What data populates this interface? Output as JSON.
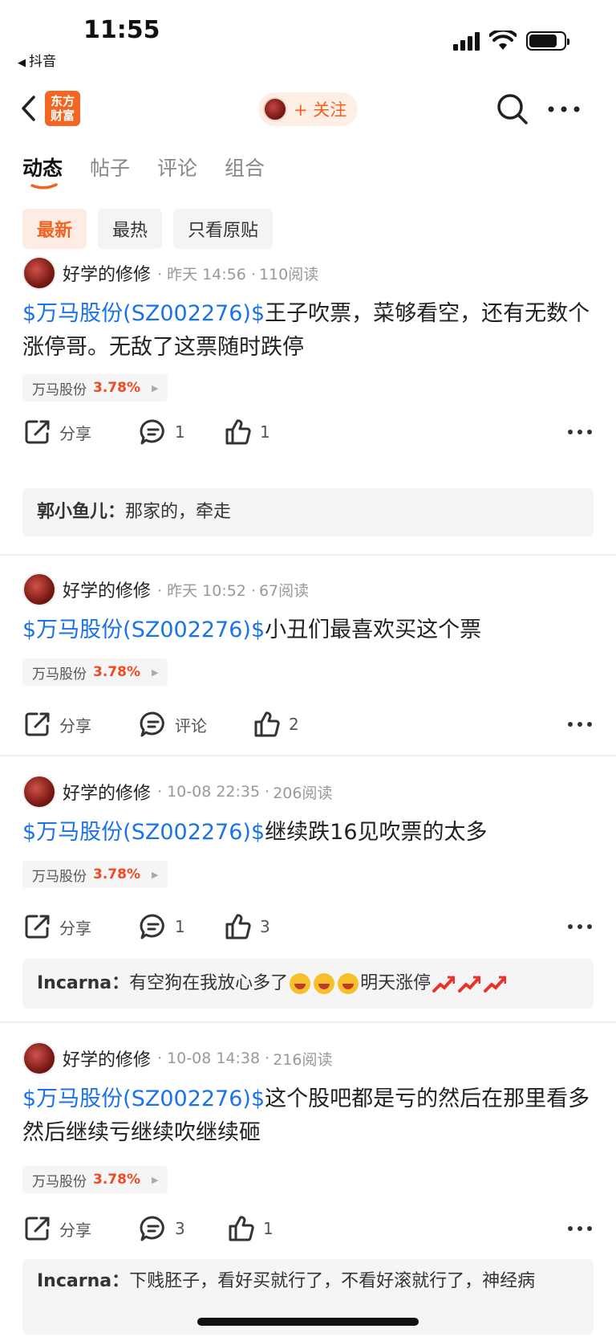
{
  "status_bar": {
    "time": "11:55",
    "back_app": "抖音"
  },
  "nav": {
    "logo_text": "东方财富",
    "follow_label": "+ 关注"
  },
  "tabs": [
    {
      "label": "动态",
      "active": true
    },
    {
      "label": "帖子",
      "active": false
    },
    {
      "label": "评论",
      "active": false
    },
    {
      "label": "组合",
      "active": false
    }
  ],
  "filters": [
    {
      "label": "最新",
      "active": true
    },
    {
      "label": "最热",
      "active": false
    },
    {
      "label": "只看原贴",
      "active": false
    }
  ],
  "colors": {
    "brand": "#f2611f",
    "link": "#1a73e8",
    "up": "#f04a23"
  },
  "posts": [
    {
      "author": "好学的修修",
      "time": "· 昨天 14:56 ·",
      "reads": "110阅读",
      "tag": "$万马股份(SZ002276)$",
      "text": "王子吹票，菜够看空，还有无数个涨停哥。无敌了这票随时跌停",
      "stock_name": "万马股份",
      "stock_pct": "3.78%",
      "share": "分享",
      "comments": "1",
      "likes": "1",
      "reply": {
        "who": "郭小鱼儿：",
        "text": "那家的，牵走"
      }
    },
    {
      "author": "好学的修修",
      "time": "· 昨天 10:52 ·",
      "reads": "67阅读",
      "tag": "$万马股份(SZ002276)$",
      "text": "小丑们最喜欢买这个票",
      "stock_name": "万马股份",
      "stock_pct": "3.78%",
      "share": "分享",
      "comments": "评论",
      "likes": "2"
    },
    {
      "author": "好学的修修",
      "time": "· 10-08 22:35 ·",
      "reads": "206阅读",
      "tag": "$万马股份(SZ002276)$",
      "text": "继续跌16见吹票的太多",
      "stock_name": "万马股份",
      "stock_pct": "3.78%",
      "share": "分享",
      "comments": "1",
      "likes": "3",
      "reply": {
        "who": "Incarna：",
        "text": "有空狗在我放心多了",
        "text2": "明天涨停"
      }
    },
    {
      "author": "好学的修修",
      "time": "· 10-08 14:38 ·",
      "reads": "216阅读",
      "tag": "$万马股份(SZ002276)$",
      "text": "这个股吧都是亏的然后在那里看多然后继续亏继续吹继续砸",
      "stock_name": "万马股份",
      "stock_pct": "3.78%",
      "share": "分享",
      "comments": "3",
      "likes": "1",
      "reply": {
        "who": "Incarna：",
        "text": "下贱胚子，看好买就行了，不看好滚就行了，神经病"
      }
    }
  ]
}
